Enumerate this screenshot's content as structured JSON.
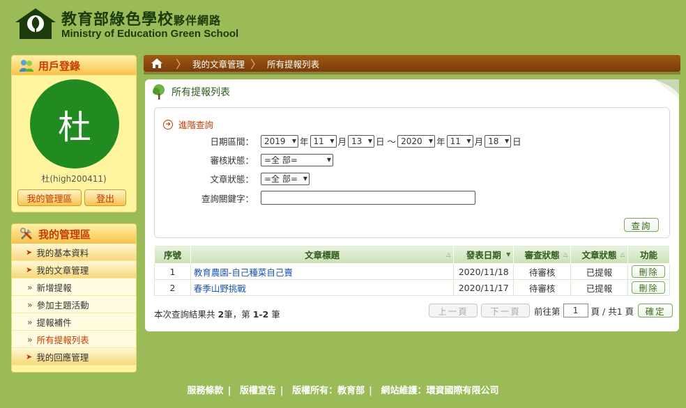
{
  "header": {
    "title_main": "教育部綠色學校",
    "title_sub": "夥伴網路",
    "title_en": "Ministry of Education Green School",
    "logo_caption": "綠色學校"
  },
  "login_panel": {
    "title": "用戶登錄",
    "avatar_char": "杜",
    "username": "杜(high200411)",
    "manage_btn": "我的管理區",
    "logout_btn": "登出"
  },
  "mgmt_panel": {
    "title": "我的管理區",
    "items": [
      {
        "label": "我的基本資料",
        "type": "main"
      },
      {
        "label": "我的文章管理",
        "type": "main"
      },
      {
        "label": "新增提報",
        "type": "sub"
      },
      {
        "label": "參加主題活動",
        "type": "sub"
      },
      {
        "label": "提報補件",
        "type": "sub"
      },
      {
        "label": "所有提報列表",
        "type": "sub"
      },
      {
        "label": "我的回應管理",
        "type": "main"
      }
    ]
  },
  "breadcrumb": [
    "我的文章管理",
    "所有提報列表"
  ],
  "content": {
    "title": "所有提報列表",
    "advanced_search": "進階查詢",
    "date_label": "日期區間：",
    "date_from": {
      "year": "2019",
      "month": "11",
      "day": "13"
    },
    "date_to": {
      "year": "2020",
      "month": "11",
      "day": "18"
    },
    "unit_year": "年",
    "unit_month": "月",
    "unit_day": "日",
    "range_sep": "～",
    "review_label": "審核狀態：",
    "review_value": "=全 部=",
    "article_label": "文章狀態：",
    "article_value": "=全 部=",
    "keyword_label": "查詢關鍵字：",
    "keyword_value": "",
    "search_btn": "查詢"
  },
  "table": {
    "headers": [
      "序號",
      "文章標題",
      "發表日期",
      "審查狀態",
      "文章狀態",
      "功能"
    ],
    "rows": [
      {
        "no": "1",
        "title": "教育農園-自己種菜自己賣",
        "date": "2020/11/18",
        "review": "待審核",
        "status": "已提報",
        "action": "刪除"
      },
      {
        "no": "2",
        "title": "春季山野挑戰",
        "date": "2020/11/17",
        "review": "待審核",
        "status": "已提報",
        "action": "刪除"
      }
    ]
  },
  "result": {
    "prefix": "本次查詢結果共",
    "count": "2",
    "mid": "筆，第",
    "range": "1-2",
    "suffix": "筆"
  },
  "pager": {
    "prev": "上一頁",
    "next": "下一頁",
    "goto_prefix": "前往第",
    "page_value": "1",
    "goto_suffix": "頁",
    "total": "/ 共1 頁",
    "confirm": "確定"
  },
  "footer": {
    "links": [
      "服務條款",
      "版權宣告",
      "版權所有：教育部",
      "網站維護：環資國際有限公司"
    ]
  },
  "colors": {
    "background": "#9bbb59",
    "accent_orange": "#c63b00",
    "breadcrumb_brown": "#7a3b07",
    "avatar_green": "#218b21"
  }
}
